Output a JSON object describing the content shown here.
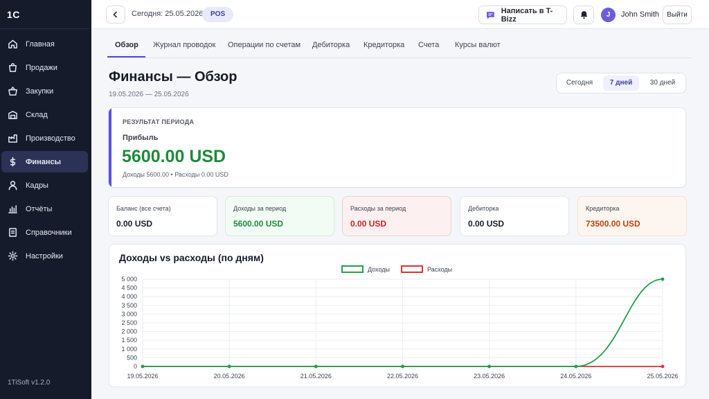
{
  "sidebar": {
    "logo": "1С",
    "version": "1TiSoft v1.2.0",
    "items": [
      {
        "label": "Главная",
        "icon": "home-icon"
      },
      {
        "label": "Продажи",
        "icon": "shopping-bag-icon"
      },
      {
        "label": "Закупки",
        "icon": "basket-icon"
      },
      {
        "label": "Склад",
        "icon": "warehouse-icon"
      },
      {
        "label": "Производство",
        "icon": "factory-icon"
      },
      {
        "label": "Финансы",
        "icon": "dollar-icon",
        "active": true
      },
      {
        "label": "Кадры",
        "icon": "user-icon"
      },
      {
        "label": "Отчёты",
        "icon": "bar-chart-icon"
      },
      {
        "label": "Справочники",
        "icon": "book-icon"
      },
      {
        "label": "Настройки",
        "icon": "gear-icon"
      }
    ]
  },
  "topbar": {
    "today": "Сегодня: 25.05.2026",
    "pos_badge": "POS",
    "tbizz_button": "Написать в T-Bizz",
    "user_initial": "J",
    "user_name": "John Smith",
    "logout": "Выйти"
  },
  "tabs": [
    {
      "label": "Обзор",
      "active": true
    },
    {
      "label": "Журнал проводок"
    },
    {
      "label": "Операции по счетам"
    },
    {
      "label": "Дебиторка"
    },
    {
      "label": "Кредиторка"
    },
    {
      "label": "Счета"
    },
    {
      "label": "Курсы валют"
    }
  ],
  "header": {
    "title": "Финансы — Обзор",
    "range": "19.05.2026 — 25.05.2026",
    "periods": [
      {
        "label": "Сегодня"
      },
      {
        "label": "7 дней",
        "active": true
      },
      {
        "label": "30 дней"
      }
    ]
  },
  "result": {
    "section_label": "РЕЗУЛЬТАТ ПЕРИОДА",
    "profit_label": "Прибыль",
    "profit_value": "5600.00 USD",
    "detail": "Доходы 5600.00  •  Расходы 0.00 USD"
  },
  "kpis": [
    {
      "label": "Баланс (все счета)",
      "value": "0.00 USD",
      "tone": "neutral"
    },
    {
      "label": "Доходы за период",
      "value": "5600.00 USD",
      "tone": "green"
    },
    {
      "label": "Расходы за период",
      "value": "0.00 USD",
      "tone": "red"
    },
    {
      "label": "Дебиторка",
      "value": "0.00 USD",
      "tone": "neutral"
    },
    {
      "label": "Кредиторка",
      "value": "73500.00 USD",
      "tone": "orange"
    }
  ],
  "chart_title": "Доходы vs расходы (по дням)",
  "chart_data": {
    "type": "line",
    "title": "Доходы vs расходы (по дням)",
    "x": [
      "19.05.2026",
      "20.05.2026",
      "21.05.2026",
      "22.05.2026",
      "23.05.2026",
      "24.05.2026",
      "25.05.2026"
    ],
    "series": [
      {
        "name": "Доходы",
        "color": "#22a04b",
        "values": [
          0,
          0,
          0,
          0,
          0,
          0,
          5000
        ]
      },
      {
        "name": "Расходы",
        "color": "#e03131",
        "values": [
          0,
          0,
          0,
          0,
          0,
          0,
          0
        ]
      }
    ],
    "ylim": [
      0,
      5000
    ],
    "yticks": [
      "0",
      "500",
      "1 000",
      "1 500",
      "2 000",
      "2 500",
      "3 000",
      "3 500",
      "4 000",
      "4 500",
      "5 000"
    ],
    "grid": true,
    "legend": "top-center"
  }
}
